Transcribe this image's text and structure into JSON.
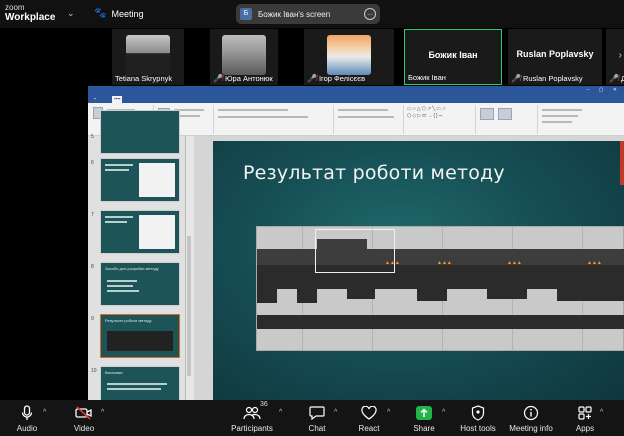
{
  "app": {
    "logo_top": "zoom",
    "logo_bottom": "Workplace"
  },
  "meeting": {
    "label": "Meeting"
  },
  "screen_share": {
    "avatar_letter": "Б",
    "title": "Божик Іван's screen",
    "more": "..."
  },
  "participants": [
    {
      "name": "Tetiana Skrypnyk",
      "muted": false
    },
    {
      "name": "Юра Антонюк",
      "muted": true
    },
    {
      "name": "Ігор Фелісєєв",
      "muted": true
    },
    {
      "name": "Божик Іван",
      "display": "Божик Іван",
      "muted": false,
      "active": true
    },
    {
      "name": "Ruslan Poplavsky",
      "display": "Ruslan Poplavsky",
      "muted": true
    },
    {
      "name": "Де",
      "muted": true
    }
  ],
  "slide": {
    "title": "Результат роботи методу"
  },
  "thumbnails": [
    {
      "num": "5"
    },
    {
      "num": "6"
    },
    {
      "num": "7"
    },
    {
      "num": "8",
      "title": "Засоби для розробки методу"
    },
    {
      "num": "9",
      "title": "Результат роботи методу",
      "selected": true
    },
    {
      "num": "10",
      "title": "Висновки"
    }
  ],
  "toolbar": {
    "audio": "Audio",
    "video": "Video",
    "participants": "Participants",
    "participants_count": "36",
    "chat": "Chat",
    "react": "React",
    "share": "Share",
    "host_tools": "Host tools",
    "meeting_info": "Meeting info",
    "apps": "Apps"
  },
  "colors": {
    "active_tile": "#2ecc71",
    "share_green": "#22b34b",
    "mic_off": "#e53935",
    "slide_bg": "#164f55"
  }
}
